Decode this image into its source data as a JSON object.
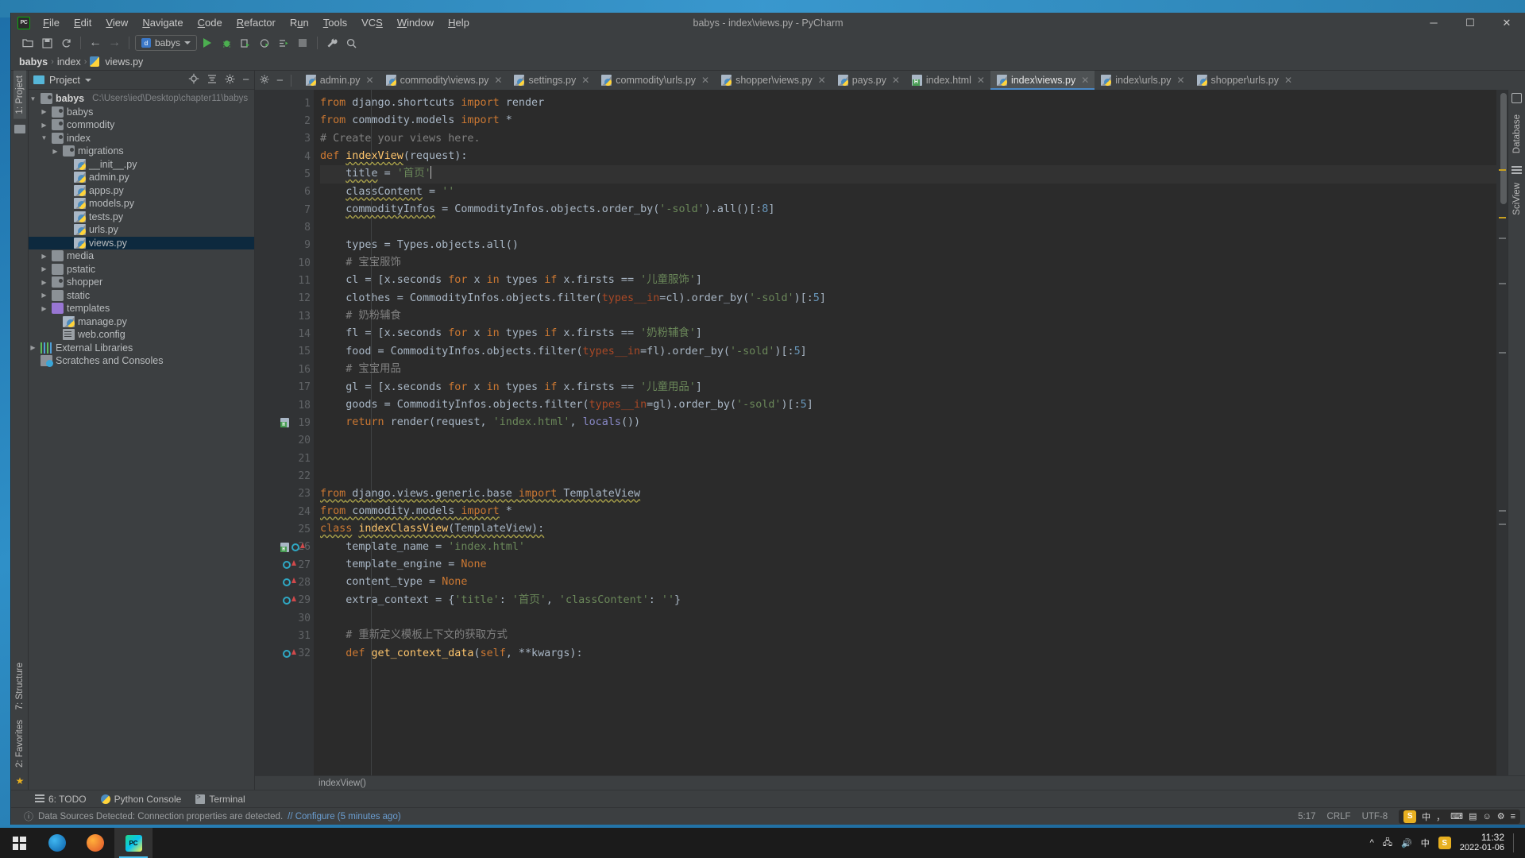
{
  "window": {
    "title": "babys - index\\views.py - PyCharm",
    "logo_text": "PC",
    "minimize": "─",
    "maximize": "☐",
    "close": "✕"
  },
  "menu": [
    {
      "label": "File"
    },
    {
      "label": "Edit"
    },
    {
      "label": "View"
    },
    {
      "label": "Navigate"
    },
    {
      "label": "Code"
    },
    {
      "label": "Refactor"
    },
    {
      "label": "Run"
    },
    {
      "label": "Tools"
    },
    {
      "label": "VCS"
    },
    {
      "label": "Window"
    },
    {
      "label": "Help"
    }
  ],
  "toolbar": {
    "open_icon": "open-folder-icon",
    "save_icon": "save-icon",
    "sync_icon": "sync-icon",
    "back_icon": "←",
    "forward_icon": "→",
    "run_config": "babys",
    "run_icon": "run-icon",
    "debug_icon": "debug-icon",
    "coverage_icon": "run-with-coverage-icon",
    "profile_icon": "profile-icon",
    "attach_icon": "attach-icon",
    "stop_icon": "stop-icon",
    "settings_icon": "wrench-icon",
    "search_icon": "🔍"
  },
  "breadcrumb": {
    "items": [
      "babys",
      "index",
      "views.py"
    ],
    "separator": "›"
  },
  "left_strip": {
    "project_tab": "1: Project",
    "structure_tab": "7: Structure",
    "favorites_tab": "2: Favorites"
  },
  "right_strip": {
    "database_tab": "Database",
    "sciview_tab": "SciView"
  },
  "project_panel": {
    "title": "Project",
    "dropdown": "▾",
    "locate_icon": "locate-icon",
    "collapse_icon": "collapse-all-icon",
    "settings_icon": "gear-icon",
    "hide_icon": "hide-icon",
    "tree": [
      {
        "label": "babys",
        "path": "C:\\Users\\ied\\Desktop\\chapter11\\babys",
        "indent": 0,
        "arrow": "▼",
        "icon": "folder-module-icon",
        "bold": true,
        "selected": false
      },
      {
        "label": "babys",
        "path": "",
        "indent": 1,
        "arrow": "▶",
        "icon": "folder-module-icon",
        "bold": false,
        "selected": false
      },
      {
        "label": "commodity",
        "path": "",
        "indent": 1,
        "arrow": "▶",
        "icon": "folder-module-icon",
        "bold": false,
        "selected": false
      },
      {
        "label": "index",
        "path": "",
        "indent": 1,
        "arrow": "▼",
        "icon": "folder-module-icon",
        "bold": false,
        "selected": false
      },
      {
        "label": "migrations",
        "path": "",
        "indent": 2,
        "arrow": "▶",
        "icon": "folder-module-icon",
        "bold": false,
        "selected": false
      },
      {
        "label": "__init__.py",
        "path": "",
        "indent": 3,
        "arrow": "",
        "icon": "python-file-icon",
        "bold": false,
        "selected": false
      },
      {
        "label": "admin.py",
        "path": "",
        "indent": 3,
        "arrow": "",
        "icon": "python-file-icon",
        "bold": false,
        "selected": false
      },
      {
        "label": "apps.py",
        "path": "",
        "indent": 3,
        "arrow": "",
        "icon": "python-file-icon",
        "bold": false,
        "selected": false
      },
      {
        "label": "models.py",
        "path": "",
        "indent": 3,
        "arrow": "",
        "icon": "python-file-icon",
        "bold": false,
        "selected": false
      },
      {
        "label": "tests.py",
        "path": "",
        "indent": 3,
        "arrow": "",
        "icon": "python-file-icon",
        "bold": false,
        "selected": false
      },
      {
        "label": "urls.py",
        "path": "",
        "indent": 3,
        "arrow": "",
        "icon": "python-file-icon",
        "bold": false,
        "selected": false
      },
      {
        "label": "views.py",
        "path": "",
        "indent": 3,
        "arrow": "",
        "icon": "python-file-icon",
        "bold": false,
        "selected": true
      },
      {
        "label": "media",
        "path": "",
        "indent": 1,
        "arrow": "▶",
        "icon": "folder-icon",
        "bold": false,
        "selected": false
      },
      {
        "label": "pstatic",
        "path": "",
        "indent": 1,
        "arrow": "▶",
        "icon": "folder-icon",
        "bold": false,
        "selected": false
      },
      {
        "label": "shopper",
        "path": "",
        "indent": 1,
        "arrow": "▶",
        "icon": "folder-module-icon",
        "bold": false,
        "selected": false
      },
      {
        "label": "static",
        "path": "",
        "indent": 1,
        "arrow": "▶",
        "icon": "folder-icon",
        "bold": false,
        "selected": false
      },
      {
        "label": "templates",
        "path": "",
        "indent": 1,
        "arrow": "▶",
        "icon": "folder-templates-icon",
        "bold": false,
        "selected": false
      },
      {
        "label": "manage.py",
        "path": "",
        "indent": 2,
        "arrow": "",
        "icon": "python-file-icon",
        "bold": false,
        "selected": false
      },
      {
        "label": "web.config",
        "path": "",
        "indent": 2,
        "arrow": "",
        "icon": "config-file-icon",
        "bold": false,
        "selected": false
      },
      {
        "label": "External Libraries",
        "path": "",
        "indent": 0,
        "arrow": "▶",
        "icon": "library-icon",
        "bold": false,
        "selected": false
      },
      {
        "label": "Scratches and Consoles",
        "path": "",
        "indent": 0,
        "arrow": "",
        "icon": "scratches-icon",
        "bold": false,
        "selected": false
      }
    ]
  },
  "editor_tabs": [
    {
      "label": "admin.py",
      "icon": "python-file-icon",
      "active": false
    },
    {
      "label": "commodity\\views.py",
      "icon": "python-file-icon",
      "active": false
    },
    {
      "label": "settings.py",
      "icon": "python-file-icon",
      "active": false
    },
    {
      "label": "commodity\\urls.py",
      "icon": "python-file-icon",
      "active": false
    },
    {
      "label": "shopper\\views.py",
      "icon": "python-file-icon",
      "active": false
    },
    {
      "label": "pays.py",
      "icon": "python-file-icon",
      "active": false
    },
    {
      "label": "index.html",
      "icon": "html-file-icon",
      "active": false
    },
    {
      "label": "index\\views.py",
      "icon": "python-file-icon",
      "active": true
    },
    {
      "label": "index\\urls.py",
      "icon": "python-file-icon",
      "active": false
    },
    {
      "label": "shopper\\urls.py",
      "icon": "python-file-icon",
      "active": false
    }
  ],
  "code_lines": [
    {
      "n": 1,
      "fold": "⊖",
      "gutter": "",
      "current": false
    },
    {
      "n": 2,
      "fold": "⊖",
      "gutter": "",
      "current": false
    },
    {
      "n": 3,
      "fold": "",
      "gutter": "",
      "current": false
    },
    {
      "n": 4,
      "fold": "⊖",
      "gutter": "",
      "current": false
    },
    {
      "n": 5,
      "fold": "",
      "gutter": "",
      "current": true
    },
    {
      "n": 6,
      "fold": "",
      "gutter": "",
      "current": false
    },
    {
      "n": 7,
      "fold": "",
      "gutter": "",
      "current": false
    },
    {
      "n": 8,
      "fold": "",
      "gutter": "",
      "current": false
    },
    {
      "n": 9,
      "fold": "",
      "gutter": "",
      "current": false
    },
    {
      "n": 10,
      "fold": "",
      "gutter": "",
      "current": false
    },
    {
      "n": 11,
      "fold": "",
      "gutter": "",
      "current": false
    },
    {
      "n": 12,
      "fold": "",
      "gutter": "",
      "current": false
    },
    {
      "n": 13,
      "fold": "",
      "gutter": "",
      "current": false
    },
    {
      "n": 14,
      "fold": "",
      "gutter": "",
      "current": false
    },
    {
      "n": 15,
      "fold": "",
      "gutter": "",
      "current": false
    },
    {
      "n": 16,
      "fold": "",
      "gutter": "",
      "current": false
    },
    {
      "n": 17,
      "fold": "",
      "gutter": "",
      "current": false
    },
    {
      "n": 18,
      "fold": "",
      "gutter": "",
      "current": false
    },
    {
      "n": 19,
      "fold": "⊖",
      "gutter": "html",
      "current": false
    },
    {
      "n": 20,
      "fold": "",
      "gutter": "",
      "current": false
    },
    {
      "n": 21,
      "fold": "",
      "gutter": "",
      "current": false
    },
    {
      "n": 22,
      "fold": "",
      "gutter": "",
      "current": false
    },
    {
      "n": 23,
      "fold": "",
      "gutter": "",
      "current": false
    },
    {
      "n": 24,
      "fold": "",
      "gutter": "",
      "current": false
    },
    {
      "n": 25,
      "fold": "⊖",
      "gutter": "",
      "current": false
    },
    {
      "n": 26,
      "fold": "",
      "gutter": "html+override",
      "current": false
    },
    {
      "n": 27,
      "fold": "",
      "gutter": "override",
      "current": false
    },
    {
      "n": 28,
      "fold": "",
      "gutter": "override",
      "current": false
    },
    {
      "n": 29,
      "fold": "",
      "gutter": "override",
      "current": false
    },
    {
      "n": 30,
      "fold": "",
      "gutter": "",
      "current": false
    },
    {
      "n": 31,
      "fold": "",
      "gutter": "",
      "current": false
    },
    {
      "n": 32,
      "fold": "⊖",
      "gutter": "override",
      "current": false
    }
  ],
  "code_text": {
    "l1": "from django.shortcuts import render",
    "l2": "from commodity.models import *",
    "l3": "# Create your views here.",
    "l4": "def indexView(request):",
    "l5": "    title = '首页'",
    "l6": "    classContent = ''",
    "l7": "    commodityInfos = CommodityInfos.objects.order_by('-sold').all()[:8]",
    "l8": "",
    "l9": "    types = Types.objects.all()",
    "l10": "    # 宝宝服饰",
    "l11": "    cl = [x.seconds for x in types if x.firsts == '儿童服饰']",
    "l12": "    clothes = CommodityInfos.objects.filter(types__in=cl).order_by('-sold')[:5]",
    "l13": "    # 奶粉辅食",
    "l14": "    fl = [x.seconds for x in types if x.firsts == '奶粉辅食']",
    "l15": "    food = CommodityInfos.objects.filter(types__in=fl).order_by('-sold')[:5]",
    "l16": "    # 宝宝用品",
    "l17": "    gl = [x.seconds for x in types if x.firsts == '儿童用品']",
    "l18": "    goods = CommodityInfos.objects.filter(types__in=gl).order_by('-sold')[:5]",
    "l19": "    return render(request, 'index.html', locals())",
    "l23": "from django.views.generic.base import TemplateView",
    "l24": "from commodity.models import *",
    "l25": "class indexClassView(TemplateView):",
    "l26": "    template_name = 'index.html'",
    "l27": "    template_engine = None",
    "l28": "    content_type = None",
    "l29": "    extra_context = {'title': '首页', 'classContent': ''}",
    "l31": "    # 重新定义模板上下文的获取方式",
    "l32": "    def get_context_data(self, **kwargs):"
  },
  "editor_footer": {
    "method_breadcrumb": "indexView()"
  },
  "bottom_tabs": [
    {
      "label": "6: TODO",
      "icon": "todo-icon"
    },
    {
      "label": "Python Console",
      "icon": "python-console-icon"
    },
    {
      "label": "Terminal",
      "icon": "terminal-icon"
    }
  ],
  "status_bar": {
    "message_prefix": "Data Sources Detected: Connection properties are detected.",
    "message_link": "// Configure (5 minutes ago)",
    "caret_position": "5:17",
    "line_separator": "CRLF",
    "encoding": "UTF-8",
    "ime_lang": "中",
    "ime_brand": "S"
  },
  "taskbar": {
    "start_label": "start-button",
    "apps": [
      {
        "name": "edge-icon",
        "color": "#1a7fc1",
        "active": false
      },
      {
        "name": "firefox-icon",
        "color": "#e8701a",
        "active": false
      },
      {
        "name": "pycharm-icon",
        "color": "#21d789",
        "active": true
      }
    ],
    "tray": [
      "network-icon",
      "volume-icon",
      "ime-icon",
      "sogou-icon"
    ],
    "time": "11:32",
    "date": "2022-01-06"
  }
}
